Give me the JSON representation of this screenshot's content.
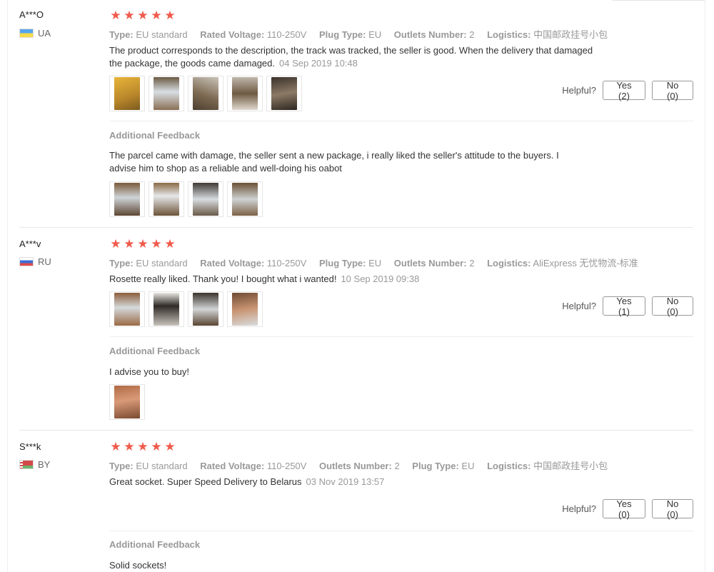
{
  "reviews": [
    {
      "user": "A***O",
      "country": "UA",
      "rating": 5,
      "attributes": [
        {
          "key": "Type:",
          "value": "EU standard"
        },
        {
          "key": "Rated Voltage:",
          "value": "110-250V"
        },
        {
          "key": "Plug Type:",
          "value": "EU"
        },
        {
          "key": "Outlets Number:",
          "value": "2"
        },
        {
          "key": "Logistics:",
          "value": "中国邮政挂号小包"
        }
      ],
      "text_line1": "The product corresponds to the description, the track was tracked, the seller is good. When the delivery that damaged",
      "text_line2": "the package, the goods came damaged.",
      "date": "04 Sep 2019 10:48",
      "helpful_label": "Helpful?",
      "yes_label": "Yes (2)",
      "no_label": "No (0)",
      "additional_title": "Additional Feedback",
      "additional_line1": "The parcel came with damage, the seller sent a new package, i really liked the seller's attitude to the buyers. I",
      "additional_line2": "advise him to shop as a reliable and well-doing his oabot"
    },
    {
      "user": "A***v",
      "country": "RU",
      "rating": 5,
      "attributes": [
        {
          "key": "Type:",
          "value": "EU standard"
        },
        {
          "key": "Rated Voltage:",
          "value": "110-250V"
        },
        {
          "key": "Plug Type:",
          "value": "EU"
        },
        {
          "key": "Outlets Number:",
          "value": "2"
        },
        {
          "key": "Logistics:",
          "value": "AliExpress 无忧物流-标准"
        }
      ],
      "text_line1": "Rosette really liked. Thank you! I bought what i wanted!",
      "date": "10 Sep 2019 09:38",
      "helpful_label": "Helpful?",
      "yes_label": "Yes (1)",
      "no_label": "No (0)",
      "additional_title": "Additional Feedback",
      "additional_line1": "I advise you to buy!"
    },
    {
      "user": "S***k",
      "country": "BY",
      "rating": 5,
      "attributes": [
        {
          "key": "Type:",
          "value": "EU standard"
        },
        {
          "key": "Rated Voltage:",
          "value": "110-250V"
        },
        {
          "key": "Outlets Number:",
          "value": "2"
        },
        {
          "key": "Plug Type:",
          "value": "EU"
        },
        {
          "key": "Logistics:",
          "value": "中国邮政挂号小包"
        }
      ],
      "text_line1": "Great socket. Super Speed Delivery to Belarus",
      "date": "03 Nov 2019 13:57",
      "helpful_label": "Helpful?",
      "yes_label": "Yes (0)",
      "no_label": "No (0)",
      "additional_title": "Additional Feedback",
      "additional_line1": "Solid sockets!"
    }
  ],
  "colors": {
    "star": "#f05a4b",
    "muted": "#999999",
    "text": "#333333"
  }
}
